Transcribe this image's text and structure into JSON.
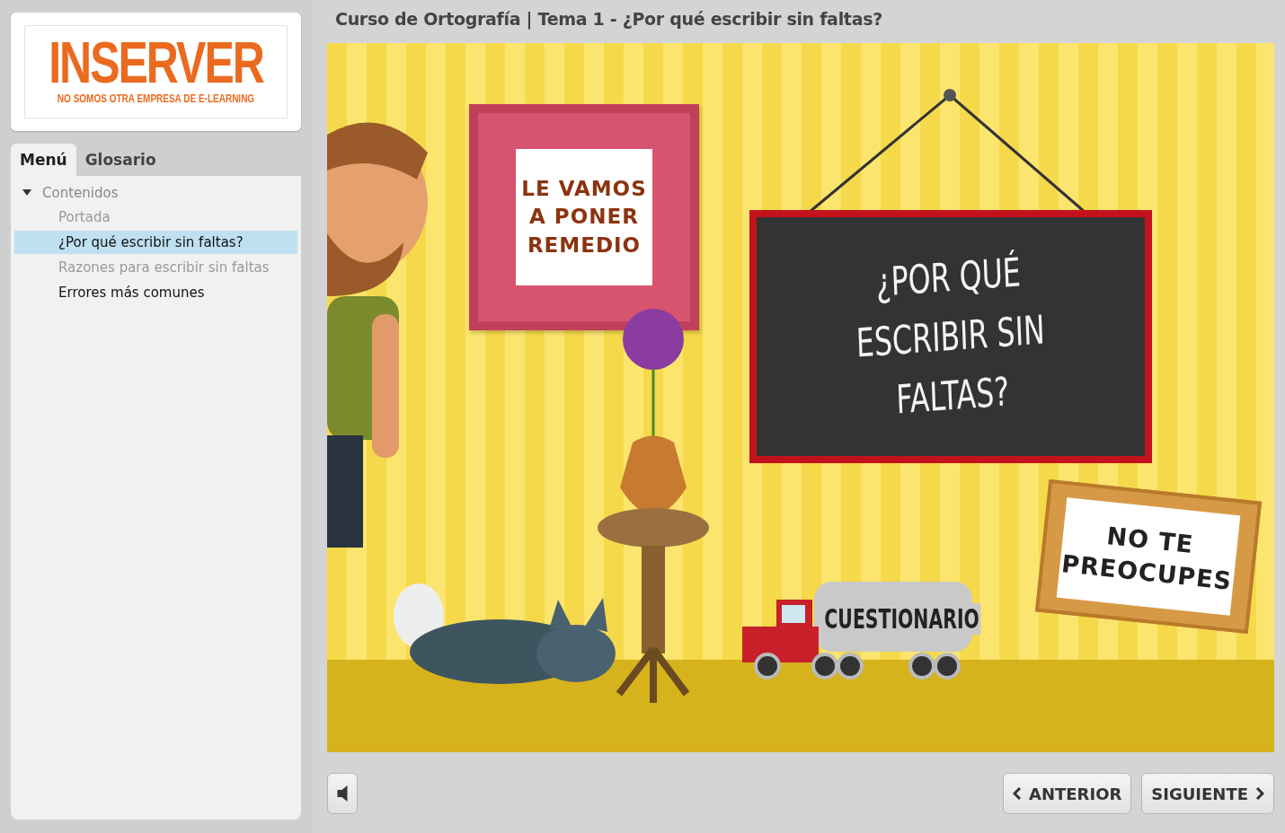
{
  "logo": {
    "name": "INSERVER",
    "tagline": "NO SOMOS OTRA EMPRESA DE E-LEARNING"
  },
  "tabs": [
    {
      "label": "Menú",
      "selected": true
    },
    {
      "label": "Glosario",
      "selected": false
    }
  ],
  "menu": {
    "label": "Contenidos",
    "expanded": true,
    "children": [
      {
        "label": "Portada",
        "selected": false,
        "visited": true
      },
      {
        "label": "¿Por qué escribir sin faltas?",
        "selected": true,
        "visited": false
      },
      {
        "label": "Razones para escribir sin faltas",
        "selected": false,
        "visited": true
      },
      {
        "label": "Errores más comunes",
        "selected": false,
        "visited": false
      }
    ]
  },
  "title": "Curso de Ortografía | Tema 1 - ¿Por qué escribir sin faltas?",
  "slide": {
    "frame_sign": "LE VAMOS\nA PONER\nREMEDIO",
    "chalkboard": "¿POR QUÉ\nESCRIBIR SIN\nFALTAS?",
    "wood_sign": "NO TE\nPREOCUPES",
    "truck_label": "CUESTIONARIO"
  },
  "controls": {
    "muted": false,
    "prev": "ANTERIOR",
    "next": "SIGUIENTE"
  }
}
